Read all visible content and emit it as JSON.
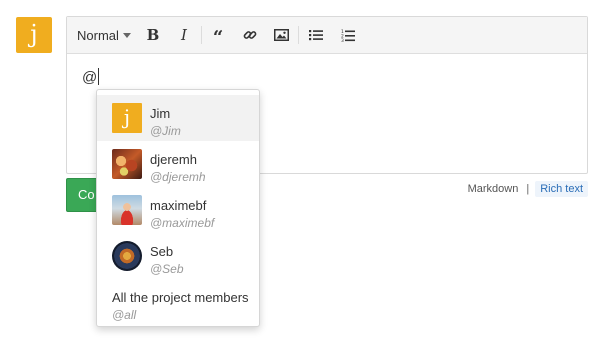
{
  "current_user": {
    "avatar_letter": "j",
    "avatar_color": "#f0ad1f"
  },
  "toolbar": {
    "format_label": "Normal",
    "bold_label": "B",
    "italic_label": "I",
    "quote_label": "“",
    "icons": [
      "link-icon",
      "image-icon",
      "bullet-list-icon",
      "numbered-list-icon"
    ]
  },
  "editor": {
    "text": "@"
  },
  "mention_menu": {
    "items": [
      {
        "name": "Jim",
        "handle": "@Jim",
        "avatar_letter": "j",
        "avatar_color": "#f0ad1f",
        "active": true
      },
      {
        "name": "djeremh",
        "handle": "@djeremh",
        "avatar": "photo"
      },
      {
        "name": "maximebf",
        "handle": "@maximebf",
        "avatar": "photo"
      },
      {
        "name": "Seb",
        "handle": "@Seb",
        "avatar": "photo"
      }
    ],
    "all": {
      "name": "All the project members",
      "handle": "@all"
    }
  },
  "submit_button": {
    "label": "Co"
  },
  "mode_switch": {
    "markdown_label": "Markdown",
    "divider": "|",
    "rich_text_label": "Rich text"
  },
  "colors": {
    "accent_green": "#3aa856",
    "link_blue": "#2a6db7"
  }
}
